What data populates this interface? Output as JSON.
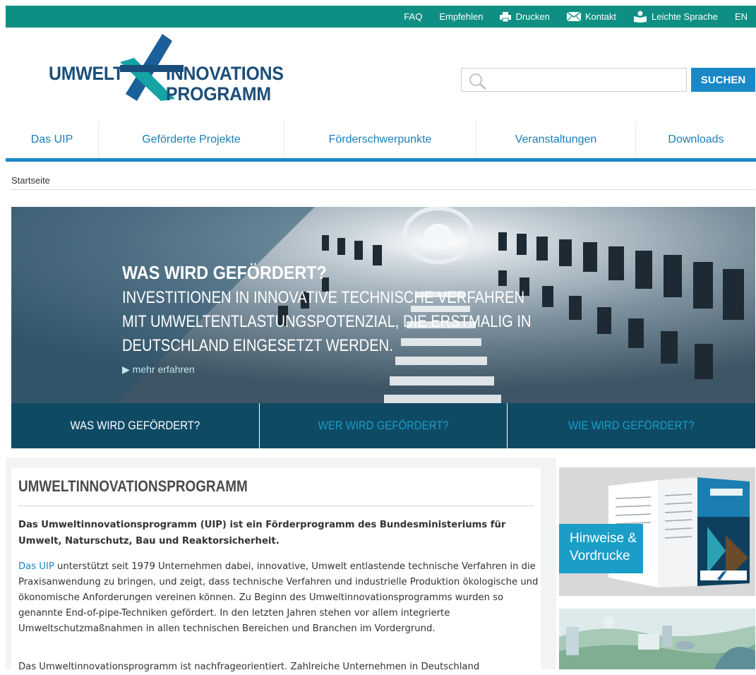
{
  "topnav": {
    "faq": "FAQ",
    "empfehlen": "Empfehlen",
    "drucken": "Drucken",
    "kontakt": "Kontakt",
    "leichte_sprache": "Leichte Sprache",
    "lang": "EN"
  },
  "logo": {
    "line1_left": "UMWELT",
    "line1_right": "INNOVATIONS",
    "line2": "PROGRAMM"
  },
  "search": {
    "placeholder": "",
    "button": "SUCHEN"
  },
  "mainnav": [
    "Das UIP",
    "Geförderte Projekte",
    "Förderschwerpunkte",
    "Veranstaltungen",
    "Downloads"
  ],
  "breadcrumb": "Startseite",
  "hero": {
    "title": "WAS WIRD GEFÖRDERT?",
    "subtitle": "INVESTITIONEN IN INNOVATIVE TECHNISCHE VERFAHREN MIT UMWELTENTLASTUNGSPOTENZIAL, DIE ERSTMALIG IN DEUTSCHLAND EINGESETZT WERDEN.",
    "more": "mehr erfahren"
  },
  "tabs": [
    "WAS WIRD GEFÖRDERT?",
    "WER WIRD GEFÖRDERT?",
    "WIE WIRD GEFÖRDERT?"
  ],
  "article": {
    "heading": "UMWELTINNOVATIONSPROGRAMM",
    "lead": "Das Umweltinnovationsprogramm (UIP) ist ein Förderprogramm des Bundesministeriums für Umwelt, Naturschutz, Bau und Reaktorsicherheit.",
    "link": "Das UIP",
    "body": " unterstützt seit 1979 Unternehmen dabei, innovative, Umwelt entlastende technische Verfahren in die Praxisanwendung zu bringen, und zeigt, dass technische Verfahren und industrielle Produktion ökologische und ökonomische Anforderungen vereinen können. Zu Beginn des Umweltinnovationsprogramms wurden so genannte End-of-pipe-Techniken gefördert. In den letzten Jahren stehen vor allem integrierte Umweltschutzmaßnahmen in allen technischen Bereichen und Branchen im Vordergrund.",
    "next": "Das Umweltinnovationsprogramm ist nachfrageorientiert. Zahlreiche Unternehmen in Deutschland"
  },
  "sidebar": {
    "box1_label_line1": "Hinweise &",
    "box1_label_line2": "Vordrucke"
  },
  "colors": {
    "topbar": "#0f8f83",
    "accent_blue": "#1a88c7",
    "tabs_bg": "#0f4a64",
    "logo_blue": "#1a4e7a",
    "logo_teal": "#16a3a4"
  }
}
